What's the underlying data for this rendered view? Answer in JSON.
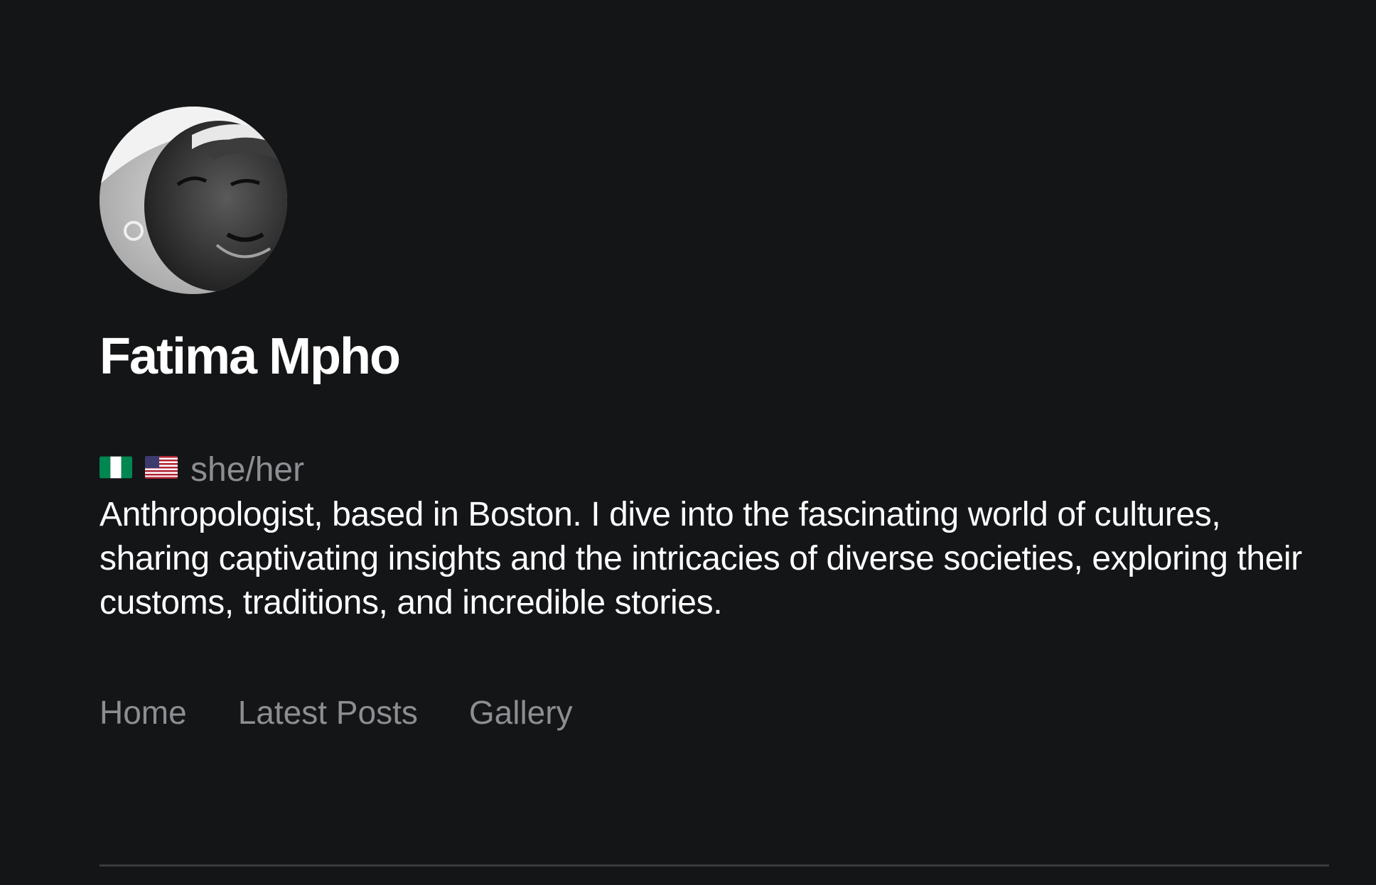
{
  "profile": {
    "name": "Fatima Mpho",
    "flags": [
      "nigeria-flag-icon",
      "usa-flag-icon"
    ],
    "pronouns": "she/her",
    "bio": "Anthropologist, based in Boston. I dive into the fascinating world of cultures, sharing captivating insights and the intricacies of diverse societies, exploring their customs, traditions, and incredible stories."
  },
  "nav": {
    "items": [
      {
        "label": "Home"
      },
      {
        "label": "Latest Posts"
      },
      {
        "label": "Gallery"
      }
    ]
  },
  "colors": {
    "background": "#141517",
    "text": "#ffffff",
    "muted": "#8d8e92",
    "divider": "#3a3b3e"
  }
}
